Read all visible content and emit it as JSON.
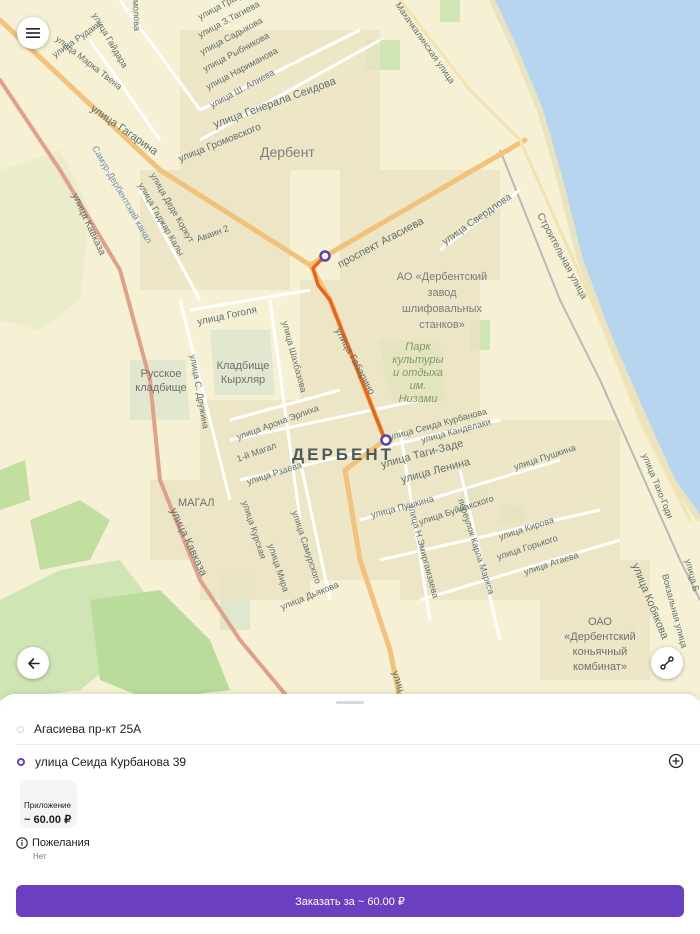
{
  "map": {
    "labels": {
      "city_district": "Дербент",
      "city_main": "ДЕРБЕНТ",
      "street_gagarina": "улица Гагарина",
      "street_kavkaza": "улица Кавказа",
      "street_kavkaza2": "улица Кавказа",
      "prospect_agasieva": "проспект Агасиева",
      "street_gen_seidova": "улица Генерала Сеидова",
      "street_gromovskogo": "улица Громовского",
      "street_aliyeva": "улица Ш. Алиева",
      "street_narimanova": "улица Наримановa",
      "street_rybnikova": "улица Рыбникова",
      "street_sadykova": "улица Садыкова",
      "street_tagieva": "улица З.Тагиева",
      "street_grafa": "улица Графа Б",
      "street_rudaki": "улица Рудаки",
      "street_marka_tvena": "улица Марка Твена",
      "street_gaydar": "улица Гайдара",
      "street_deda_korkut": "улица Деде Коркут",
      "street_gadzhar": "улица Гаджар Калы",
      "street_avain": "Аваин 2",
      "street_sverdlova": "улица Свердлова",
      "street_stroitelnaya": "Строительная улица",
      "street_makhachkalinskaya": "Махачкалинская улица",
      "street_gogolya": "улица Гоголя",
      "street_shaumyana": "улица Шаумяна",
      "street_shakhbazova": "улица Шахбазова",
      "street_gabarino": "улица Габарино",
      "street_arona_erlikha": "улица Арона Эрлиха",
      "street_s_druzhina": "улица С. Дружина",
      "street_1_magal": "1-й Магал",
      "street_rzaeva": "улица Рзаева",
      "street_kurbanova": "улица Сеида Курбанова",
      "street_kandelaki": "улица Канделаки",
      "street_tagi_zade": "улица Таги-Заде",
      "street_lenina": "улица Ленина",
      "street_pushkina": "улица Пушкина",
      "street_pushkina2": "улица Пушкина",
      "street_buinakskogo": "улица Буйнакского",
      "street_kirova": "улица Кирова",
      "street_gorkogo": "улица Горького",
      "street_ataeva": "улица Атаева",
      "street_emirgamzaeva": "улица Н.Эмиргамзаева",
      "street_karla_marksa": "переулок Карла Маркса",
      "street_kurskaya": "улица Курская",
      "street_samurskogo": "улица Самурского",
      "street_mira": "улица Мира",
      "street_dyakova": "улица Дьякова",
      "street_kobyakova": "улица Кобякова",
      "street_taho_godi": "улица Тахо-Годи",
      "street_vokzalnaya": "Вокзальная улица",
      "canal": "Самур-Дербентский канал",
      "magal": "МАГАЛ",
      "zavod_l1": "АО «Дербентский",
      "zavod_l2": "завод",
      "zavod_l3": "шлифовальных",
      "zavod_l4": "станков»",
      "park_l1": "Парк",
      "park_l2": "культуры",
      "park_l3": "и отдыха",
      "park_l4": "им.",
      "park_l5": "Низами",
      "kladbishche_l1": "Кладбище",
      "kladbishche_l2": "Кырхляр",
      "russkoe_l1": "Русское",
      "russkoe_l2": "кладбище",
      "kombinat_l1": "ОАО",
      "kombinat_l2": "«Дербентский",
      "kombinat_l3": "коньячный",
      "kombinat_l4": "комбинат»",
      "street_ulic": "улиц",
      "street_molova": "молова",
      "street_right": "улица Б"
    },
    "colors": {
      "land": "#f6f1d4",
      "water": "#b7d5ef",
      "park": "#cfe5b4",
      "route": "#e8651c",
      "main_road": "#f3c27a",
      "marker": "#5a3fb5"
    }
  },
  "buttons": {
    "menu_icon": "hamburger-icon",
    "back_icon": "arrow-left-icon",
    "route_icon": "route-icon"
  },
  "order": {
    "from_address": "Агасиева пр-кт 25А",
    "to_address": "улица Сеида Курбанова  39",
    "tariff_name": "Приложение",
    "tariff_price": "~ 60.00 ₽",
    "wishes_title": "Пожелания",
    "wishes_value": "Нет",
    "order_button": "Заказать за ~ 60.00 ₽",
    "colors": {
      "from_dot": "#d9d9d9",
      "to_dot": "#6a3fc0",
      "button": "#6a3fc0"
    }
  }
}
